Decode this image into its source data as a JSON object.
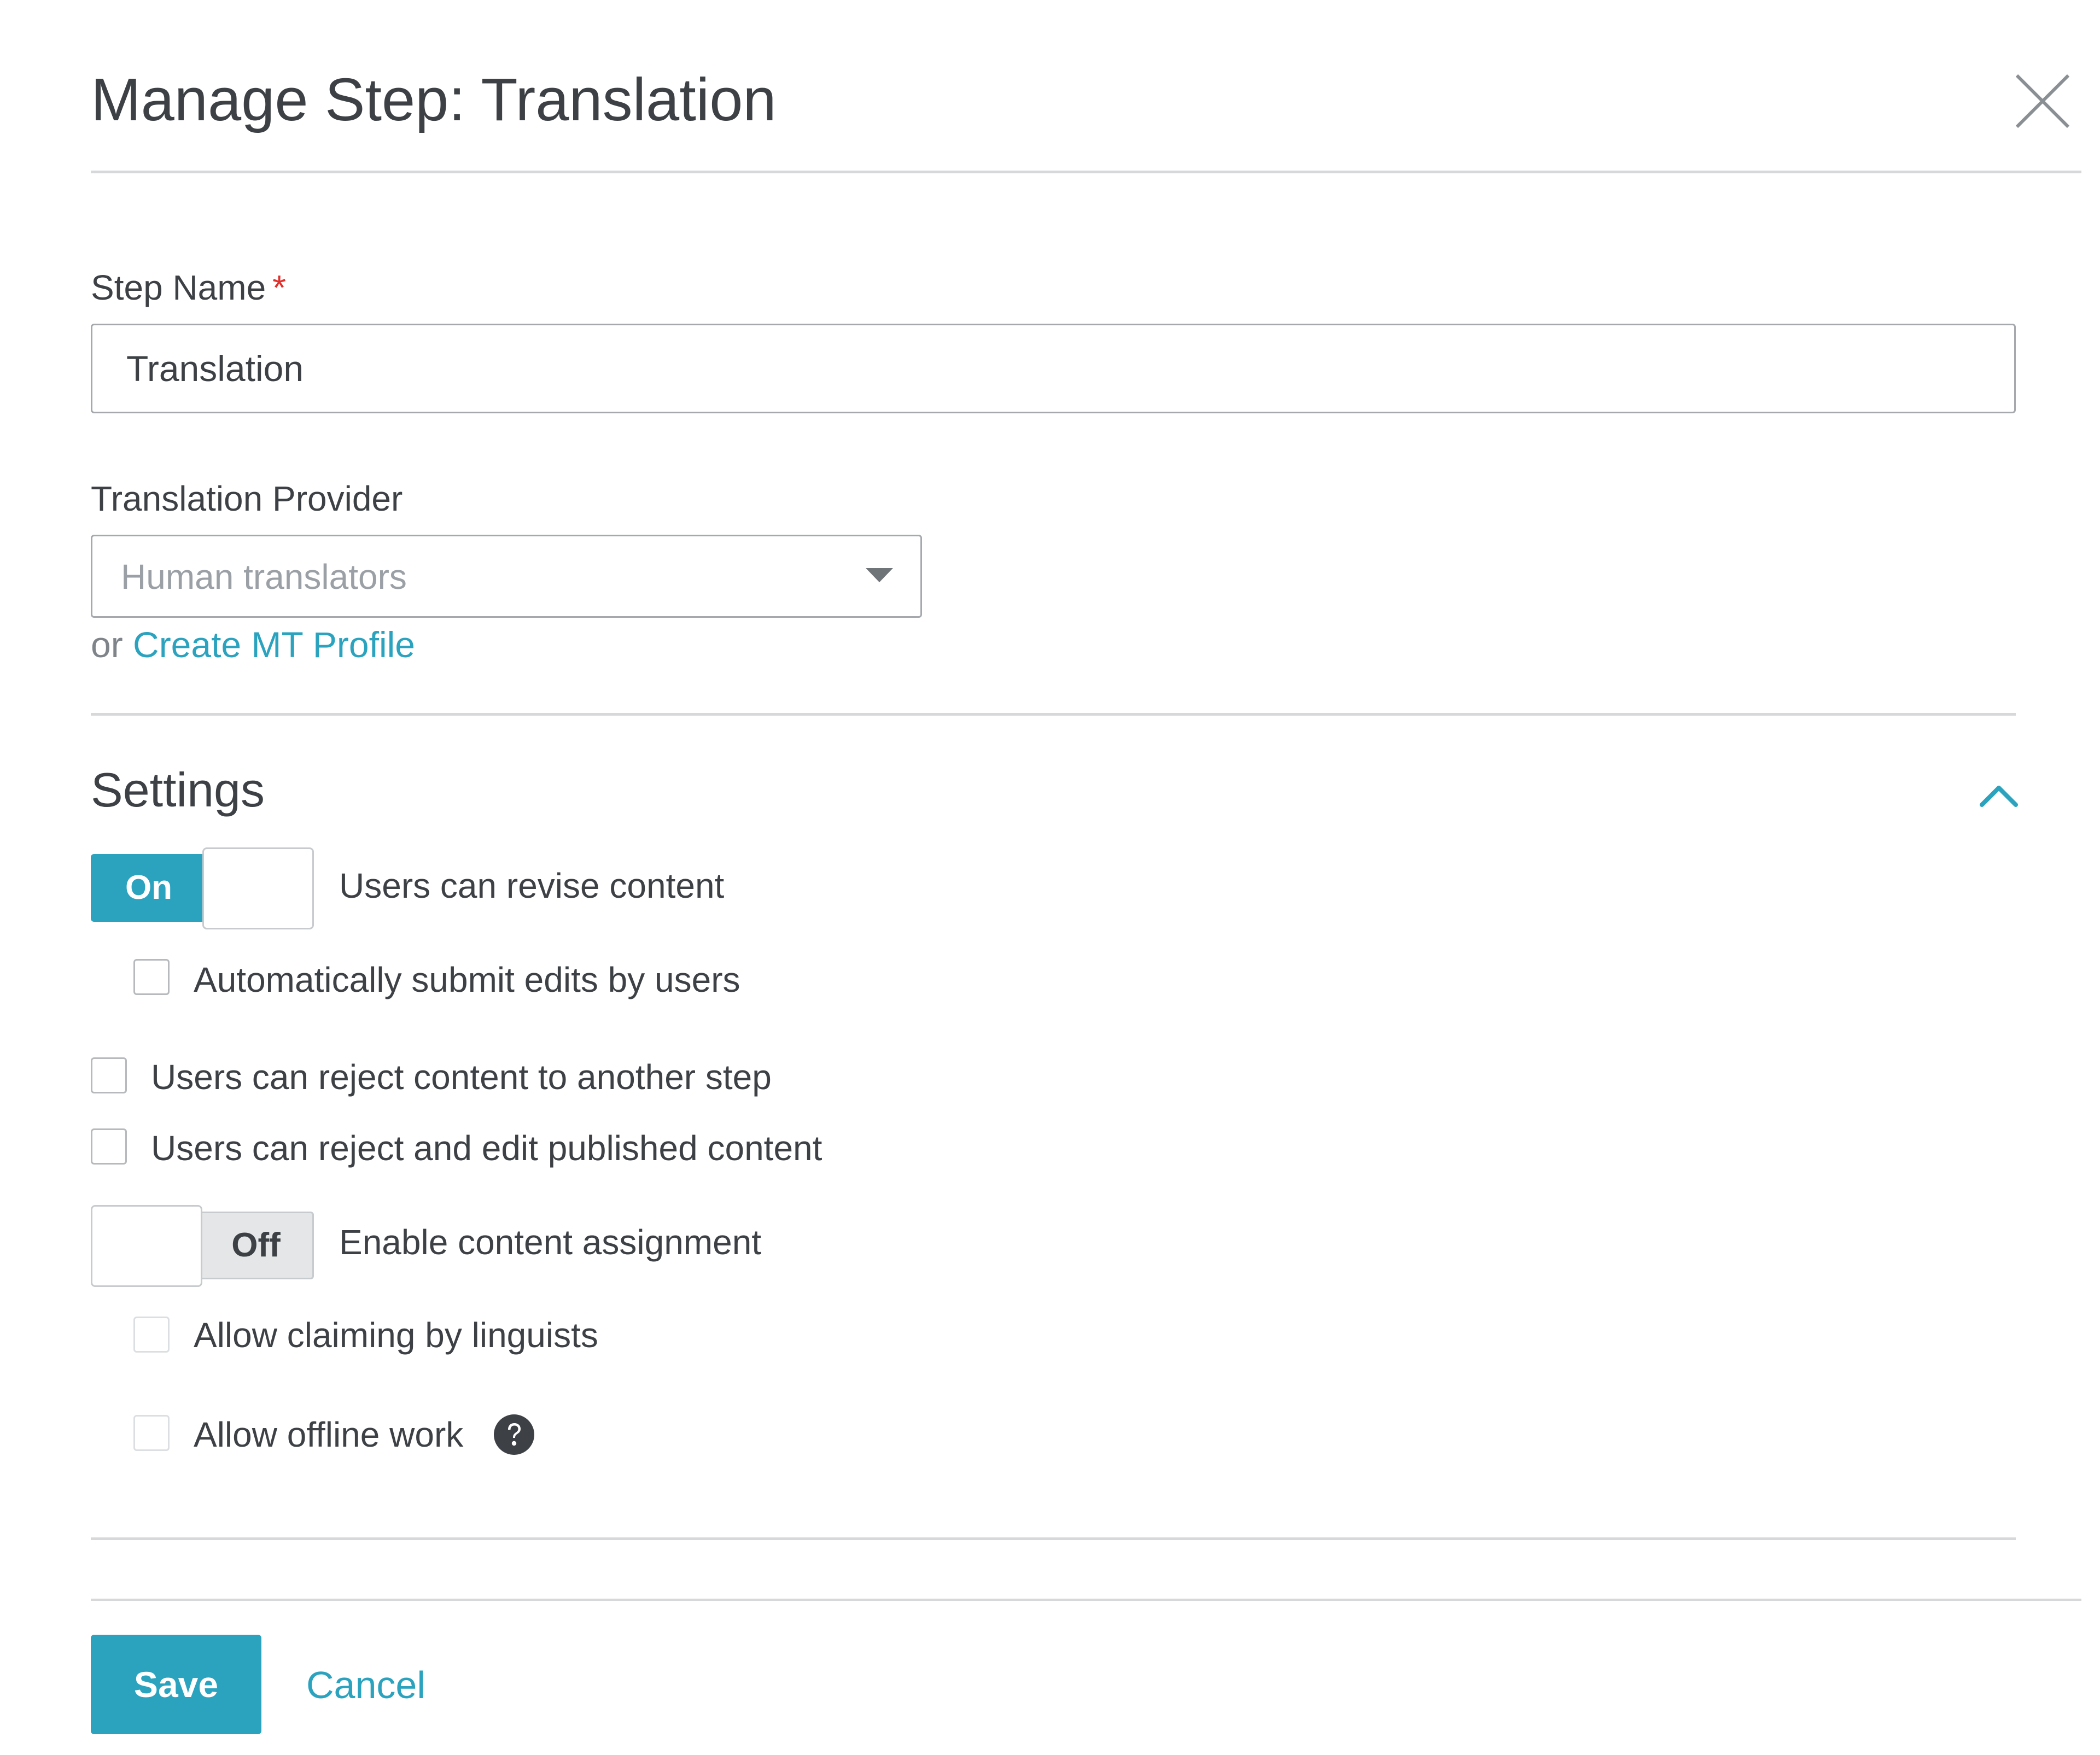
{
  "header": {
    "title": "Manage Step: Translation",
    "close_icon": "close-icon"
  },
  "form": {
    "step_name": {
      "label": "Step Name",
      "required_marker": "*",
      "value": "Translation"
    },
    "provider": {
      "label": "Translation Provider",
      "selected": "Human translators",
      "or_text": "or",
      "create_link": "Create MT Profile"
    }
  },
  "settings": {
    "title": "Settings",
    "collapse_icon": "chevron-up-icon",
    "revise_toggle": {
      "state": "On",
      "label": "Users can revise content"
    },
    "auto_submit": {
      "label": "Automatically submit edits by users",
      "checked": false
    },
    "reject_step": {
      "label": "Users can reject content to another step",
      "checked": false
    },
    "reject_published": {
      "label": "Users can reject and edit published content",
      "checked": false
    },
    "assignment_toggle": {
      "state": "Off",
      "label": "Enable content assignment"
    },
    "allow_claiming": {
      "label": "Allow claiming by linguists",
      "checked": false
    },
    "allow_offline": {
      "label": "Allow offline work",
      "checked": false,
      "help_icon": "question-circle-icon"
    }
  },
  "footer": {
    "save_label": "Save",
    "cancel_label": "Cancel"
  },
  "colors": {
    "accent": "#2ba3bf",
    "required": "#e0302c",
    "text": "#3d4145",
    "divider": "#d6d8da"
  }
}
